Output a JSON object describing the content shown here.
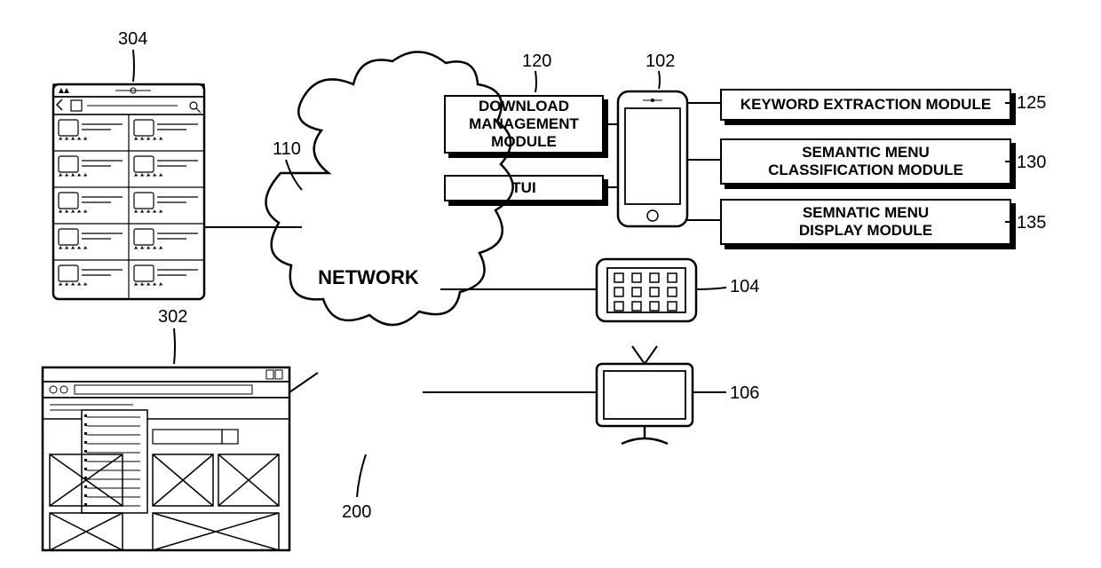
{
  "labels": {
    "n304": "304",
    "n302": "302",
    "n110": "110",
    "n200": "200",
    "n120": "120",
    "n102": "102",
    "n125": "125",
    "n130": "130",
    "n135": "135",
    "n104": "104",
    "n106": "106"
  },
  "cloud": {
    "text": "NETWORK"
  },
  "modules": {
    "download": "DOWNLOAD\nMANAGEMENT\nMODULE",
    "tui": "TUI",
    "keyword": "KEYWORD EXTRACTION MODULE",
    "semanticClass": "SEMANTIC MENU\nCLASSIFICATION MODULE",
    "semanticDisp": "SEMNATIC MENU\nDISPLAY MODULE"
  }
}
